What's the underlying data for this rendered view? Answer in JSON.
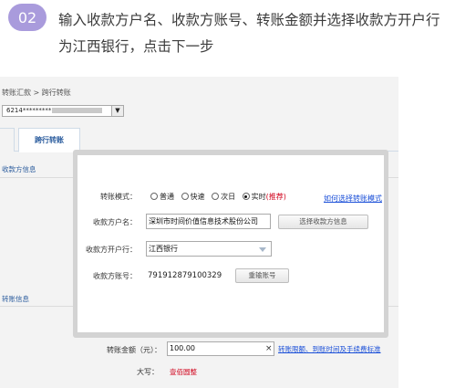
{
  "step": {
    "number": "02",
    "instruction": "输入收款方户名、收款方账号、转账金额并选择收款方开户行为江西银行，点击下一步"
  },
  "screenshot": {
    "breadcrumb": "转账汇款 > 跨行转账",
    "account_select_value": "6214*********",
    "active_tab": "跨行转账",
    "section_payee": "收款方信息",
    "section_bottom": "转账信息",
    "modal": {
      "transfer_mode_label": "转账模式：",
      "modes": [
        {
          "label": "普通",
          "selected": false
        },
        {
          "label": "快速",
          "selected": false
        },
        {
          "label": "次日",
          "selected": false
        },
        {
          "label": "实时",
          "selected": true,
          "tag": "(推荐)"
        }
      ],
      "mode_help_link": "如何选择转账模式",
      "payee_name_label": "收款方户名：",
      "payee_name_value": "深圳市时间价值信息技术股份公司",
      "select_payee_button": "选择收款方信息",
      "payee_bank_label": "收款方开户行：",
      "payee_bank_value": "江西银行",
      "payee_account_label": "收款方账号：",
      "payee_account_value": "791912879100329",
      "reenter_account_button": "重输账号"
    },
    "amount_label": "转账金额（元）：",
    "amount_value": "100.00",
    "clear_icon": "×",
    "limit_link": "转账限额、到账时间及手续费标准",
    "uppercase_label": "大写：",
    "uppercase_value": "壹佰圆整",
    "colors": {
      "badge": "#a99bdc",
      "link": "#1a4fd8",
      "highlight_red": "#d0021b",
      "tab_text": "#2c5d9e"
    }
  }
}
